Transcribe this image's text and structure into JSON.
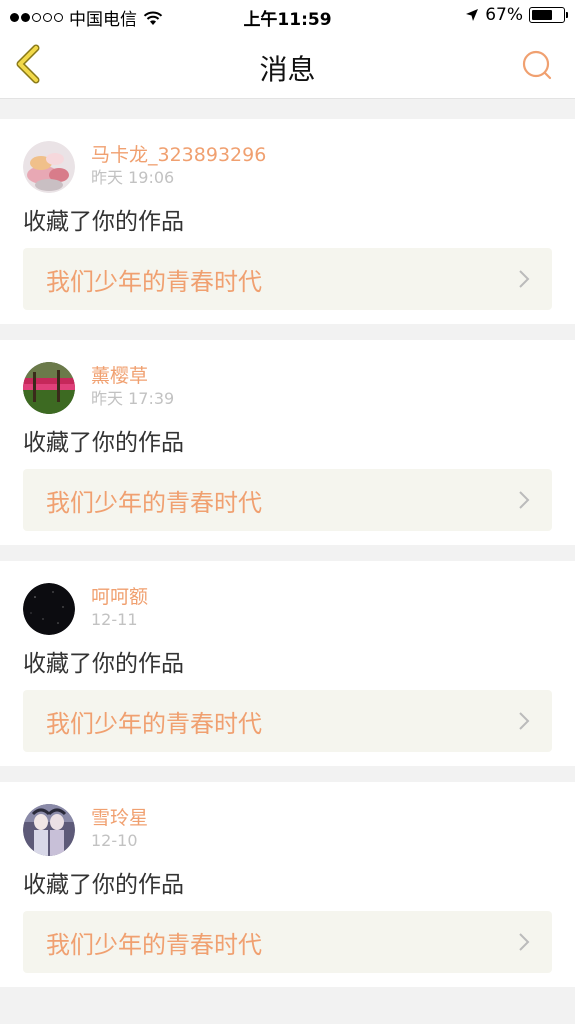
{
  "status_bar": {
    "carrier": "中国电信",
    "time": "上午11:59",
    "battery": "67%",
    "signal_dots": [
      true,
      true,
      false,
      false,
      false
    ],
    "battery_level": 0.67
  },
  "nav": {
    "title": "消息",
    "accent": "#f0a070"
  },
  "messages": [
    {
      "username": "马卡龙_323893296",
      "time": "昨天 19:06",
      "action": "收藏了你的作品",
      "work_title": "我们少年的青春时代",
      "avatar": "macaron-avatar"
    },
    {
      "username": "薰樱草",
      "time": "昨天 17:39",
      "action": "收藏了你的作品",
      "work_title": "我们少年的青春时代",
      "avatar": "flower-field-avatar"
    },
    {
      "username": "呵呵额",
      "time": "12-11",
      "action": "收藏了你的作品",
      "work_title": "我们少年的青春时代",
      "avatar": "night-sky-avatar"
    },
    {
      "username": "雪玲星",
      "time": "12-10",
      "action": "收藏了你的作品",
      "work_title": "我们少年的青春时代",
      "avatar": "anime-girls-avatar"
    }
  ]
}
